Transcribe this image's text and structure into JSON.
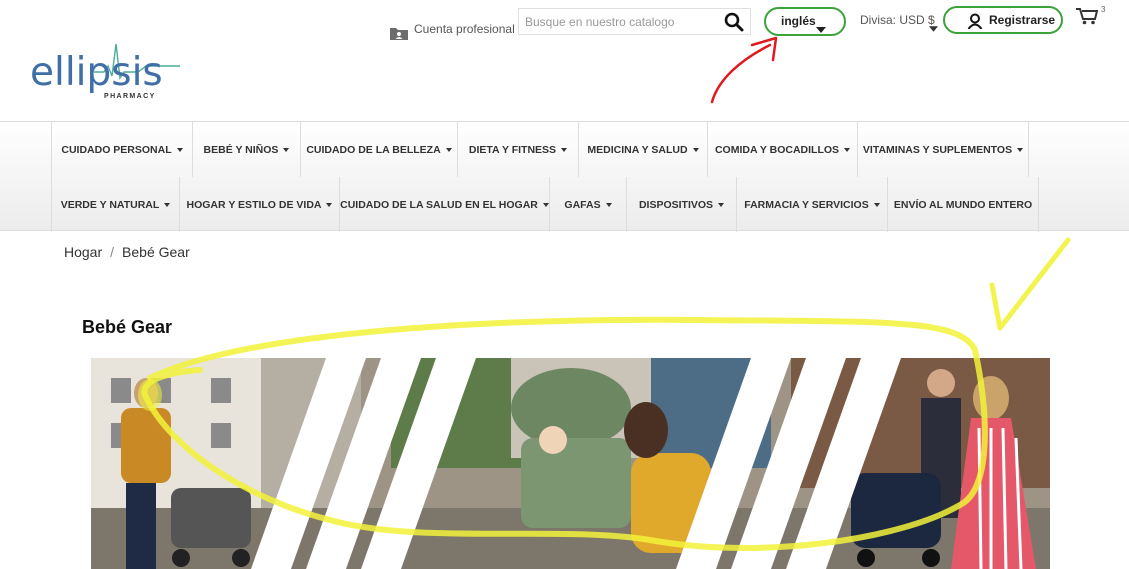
{
  "header": {
    "logo": {
      "name": "ellipsis",
      "sub": "PHARMACY"
    },
    "account_label": "Cuenta profesional",
    "search": {
      "placeholder": "Busque en nuestro catalogo",
      "value": ""
    },
    "language_label": "inglés",
    "currency_label": "Divisa: USD $",
    "register_label": "Registrarse",
    "cart_count": "3"
  },
  "nav": {
    "row1": [
      {
        "label": "CUIDADO PERSONAL",
        "dropdown": true
      },
      {
        "label": "BEBÉ Y NIÑOS",
        "dropdown": true
      },
      {
        "label": "CUIDADO DE LA BELLEZA",
        "dropdown": true
      },
      {
        "label": "DIETA Y FITNESS",
        "dropdown": true
      },
      {
        "label": "MEDICINA Y SALUD",
        "dropdown": true
      },
      {
        "label": "COMIDA Y BOCADILLOS",
        "dropdown": true
      },
      {
        "label": "VITAMINAS Y SUPLEMENTOS",
        "dropdown": true
      }
    ],
    "row2": [
      {
        "label": "VERDE Y NATURAL",
        "dropdown": true
      },
      {
        "label": "HOGAR Y ESTILO DE VIDA",
        "dropdown": true
      },
      {
        "label": "CUIDADO DE LA SALUD EN EL HOGAR",
        "dropdown": true
      },
      {
        "label": "GAFAS",
        "dropdown": true
      },
      {
        "label": "DISPOSITIVOS",
        "dropdown": true
      },
      {
        "label": "FARMACIA Y SERVICIOS",
        "dropdown": true
      },
      {
        "label": "ENVÍO AL MUNDO ENTERO",
        "dropdown": false
      }
    ]
  },
  "breadcrumb": {
    "home": "Hogar",
    "separator": "/",
    "current": "Bebé Gear"
  },
  "page_title": "Bebé Gear",
  "colors": {
    "accent_green": "#3aa33a",
    "logo_blue": "#3f6fa6",
    "annotation_red": "#e0191e",
    "annotation_yellow": "#f2f23a"
  },
  "icons": [
    "folder-user-icon",
    "search-icon",
    "chevron-down-icon",
    "user-icon",
    "cart-icon"
  ]
}
